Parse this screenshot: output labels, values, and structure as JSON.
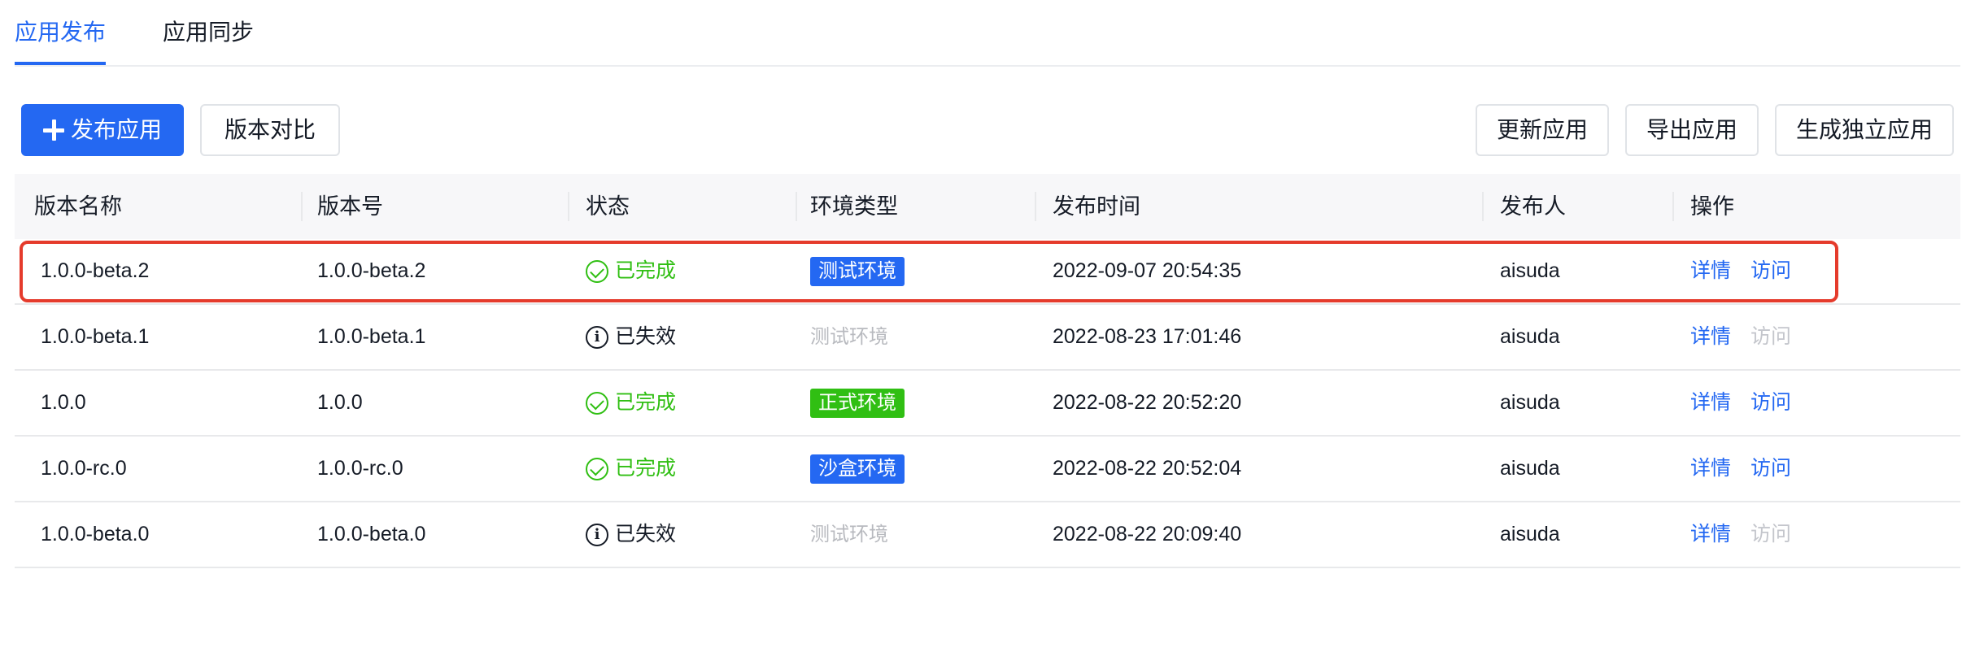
{
  "tabs": [
    {
      "label": "应用发布",
      "active": true
    },
    {
      "label": "应用同步",
      "active": false
    }
  ],
  "toolbar": {
    "publish_label": "发布应用",
    "compare_label": "版本对比",
    "update_label": "更新应用",
    "export_label": "导出应用",
    "standalone_label": "生成独立应用"
  },
  "table": {
    "columns": [
      "版本名称",
      "版本号",
      "状态",
      "环境类型",
      "发布时间",
      "发布人",
      "操作"
    ],
    "rows": [
      {
        "name": "1.0.0-beta.2",
        "version": "1.0.0-beta.2",
        "status": "已完成",
        "status_type": "ok",
        "env": "测试环境",
        "env_color": "#2468f2",
        "time": "2022-09-07 20:54:35",
        "publisher": "aisuda",
        "detail": "详情",
        "visit": "访问",
        "visit_enabled": true
      },
      {
        "name": "1.0.0-beta.1",
        "version": "1.0.0-beta.1",
        "status": "已失效",
        "status_type": "fail",
        "env": "测试环境",
        "env_color": "",
        "time": "2022-08-23 17:01:46",
        "publisher": "aisuda",
        "detail": "详情",
        "visit": "访问",
        "visit_enabled": false
      },
      {
        "name": "1.0.0",
        "version": "1.0.0",
        "status": "已完成",
        "status_type": "ok",
        "env": "正式环境",
        "env_color": "#30bf13",
        "time": "2022-08-22 20:52:20",
        "publisher": "aisuda",
        "detail": "详情",
        "visit": "访问",
        "visit_enabled": true
      },
      {
        "name": "1.0.0-rc.0",
        "version": "1.0.0-rc.0",
        "status": "已完成",
        "status_type": "ok",
        "env": "沙盒环境",
        "env_color": "#2468f2",
        "time": "2022-08-22 20:52:04",
        "publisher": "aisuda",
        "detail": "详情",
        "visit": "访问",
        "visit_enabled": true
      },
      {
        "name": "1.0.0-beta.0",
        "version": "1.0.0-beta.0",
        "status": "已失效",
        "status_type": "fail",
        "env": "测试环境",
        "env_color": "",
        "time": "2022-08-22 20:09:40",
        "publisher": "aisuda",
        "detail": "详情",
        "visit": "访问",
        "visit_enabled": false
      }
    ]
  },
  "colors": {
    "accent": "#2468f2",
    "success": "#30bf13",
    "highlight": "#e53b2c",
    "disabled": "#c4c6cc"
  }
}
